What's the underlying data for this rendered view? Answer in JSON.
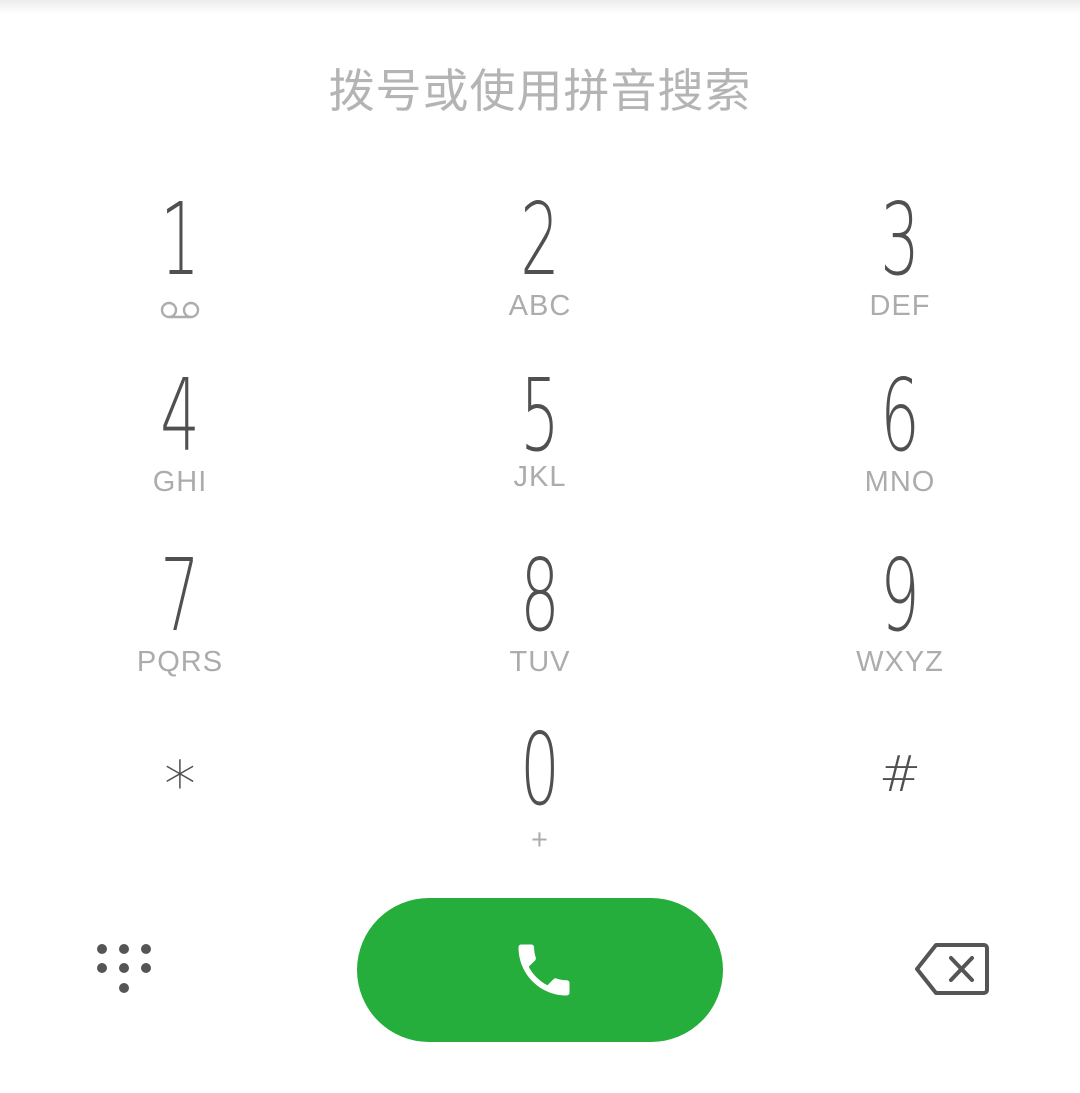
{
  "search": {
    "hint": "拨号或使用拼音搜索"
  },
  "keypad": {
    "keys": [
      {
        "digit": "1",
        "letters": "",
        "icon": "voicemail-icon"
      },
      {
        "digit": "2",
        "letters": "ABC"
      },
      {
        "digit": "3",
        "letters": "DEF"
      },
      {
        "digit": "4",
        "letters": "GHI"
      },
      {
        "digit": "5",
        "letters": "JKL"
      },
      {
        "digit": "6",
        "letters": "MNO"
      },
      {
        "digit": "7",
        "letters": "PQRS"
      },
      {
        "digit": "8",
        "letters": "TUV"
      },
      {
        "digit": "9",
        "letters": "WXYZ"
      },
      {
        "digit": "*",
        "letters": ""
      },
      {
        "digit": "0",
        "letters": "+"
      },
      {
        "digit": "#",
        "letters": ""
      }
    ]
  },
  "bottom_bar": {
    "left_icon": "dialpad-grid-icon",
    "call_icon": "phone-icon",
    "right_icon": "backspace-icon"
  },
  "colors": {
    "call_button": "#25ae3c",
    "digit": "#505050",
    "letters": "#acacac",
    "hint": "#b4b4b4"
  }
}
